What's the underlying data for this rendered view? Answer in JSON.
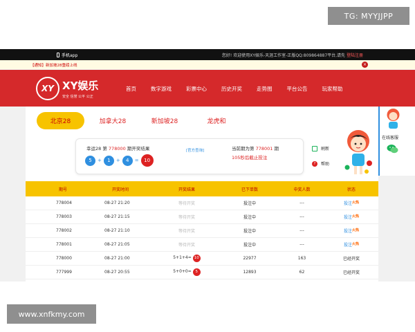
{
  "watermarks": {
    "top": "TG: MYYJJPP",
    "bottom": "www.xnfkmy.com"
  },
  "topbar": {
    "phone_label": "手机app",
    "welcome": "您好! 欢迎使用XY娱乐-天涯工作室-正版QQ:809864887平台,请先",
    "login_register": "登陆注册"
  },
  "notice": {
    "text": "【通知】新加坡28重磅上线"
  },
  "header": {
    "logo_mark": "XY",
    "brand": "XY娱乐",
    "slogan": "安全 信誉 公平 公正",
    "nav": [
      "首页",
      "数字游戏",
      "彩票中心",
      "历史开奖",
      "走势图",
      "平台公告",
      "玩家帮助"
    ]
  },
  "tabs": [
    "北京28",
    "加拿大28",
    "新加坡28",
    "龙虎和"
  ],
  "result": {
    "prefix": "幸运28 第",
    "issue": "778000",
    "suffix": "期开奖结果",
    "balls": [
      "5",
      "1",
      "4"
    ],
    "sum": "10",
    "official_link": "[官方查询]",
    "current_prefix": "当前期为第",
    "current_issue": "778001",
    "current_suffix": "期",
    "countdown": "105秒后截止投注"
  },
  "side_links": {
    "refresh": "刷新",
    "help": "帮助"
  },
  "table": {
    "headers": [
      "期号",
      "开奖时间",
      "开奖结果",
      "已下单数",
      "中奖人数",
      "状态"
    ],
    "rows": [
      {
        "issue": "778004",
        "time": "08-27 21:20",
        "result": "等待开奖",
        "orders": "投注中",
        "winners": "---",
        "status": "投注"
      },
      {
        "issue": "778003",
        "time": "08-27 21:15",
        "result": "等待开奖",
        "orders": "投注中",
        "winners": "---",
        "status": "投注"
      },
      {
        "issue": "778002",
        "time": "08-27 21:10",
        "result": "等待开奖",
        "orders": "投注中",
        "winners": "---",
        "status": "投注"
      },
      {
        "issue": "778001",
        "time": "08-27 21:05",
        "result": "等待开奖",
        "orders": "投注中",
        "winners": "---",
        "status": "投注"
      },
      {
        "issue": "778000",
        "time": "08-27 21:00",
        "result": "5+1+4=",
        "sum": "10",
        "orders": "22977",
        "winners": "163",
        "status": "已经开奖"
      },
      {
        "issue": "777999",
        "time": "08-27 20:55",
        "result": "5+0+0=",
        "sum": "5",
        "orders": "12893",
        "winners": "62",
        "status": "已经开奖"
      }
    ],
    "hot_badge": "火热"
  },
  "service": {
    "label": "在线客服"
  },
  "colors": {
    "header_red": "#d5292b",
    "accent_yellow": "#f7c300",
    "link_blue": "#2f8fe0"
  }
}
